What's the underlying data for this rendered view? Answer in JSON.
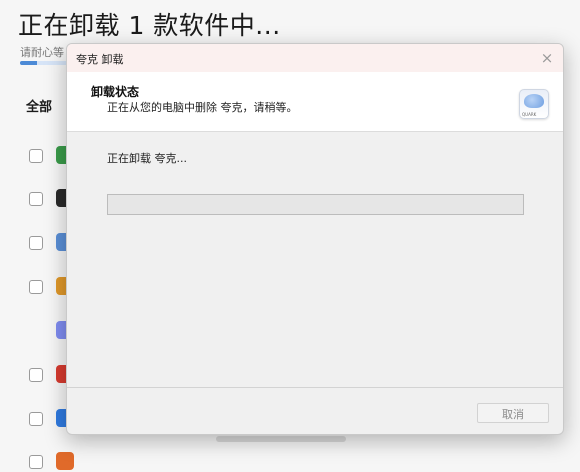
{
  "background": {
    "title": "正在卸载 1 款软件中...",
    "subtitle": "请耐心等",
    "progress_fraction": 0.35,
    "filter_label": "全部",
    "app_icons": [
      {
        "name": "chrome-icon",
        "color": "#3a9b4a"
      },
      {
        "name": "dark-app-icon",
        "color": "#2a2a2a"
      },
      {
        "name": "link-app-icon",
        "color": "#5a8fd6"
      },
      {
        "name": "video-app-icon",
        "color": "#e0982a"
      },
      {
        "name": "quark-app-icon",
        "color": "#7f8cf0"
      },
      {
        "name": "red-app-icon",
        "color": "#d63a2f"
      },
      {
        "name": "blue-app-icon",
        "color": "#2f7ae0"
      },
      {
        "name": "orange-app-icon",
        "color": "#e06a2a"
      }
    ]
  },
  "dialog": {
    "title": "夸克 卸载",
    "close_glyph": "×",
    "header": {
      "title": "卸载状态",
      "description": "正在从您的电脑中删除 夸克，请稍等。",
      "icon_text": "QUARK"
    },
    "status": "正在卸载 夸克...",
    "progress_fraction": 0.0,
    "cancel_label": "取消"
  }
}
